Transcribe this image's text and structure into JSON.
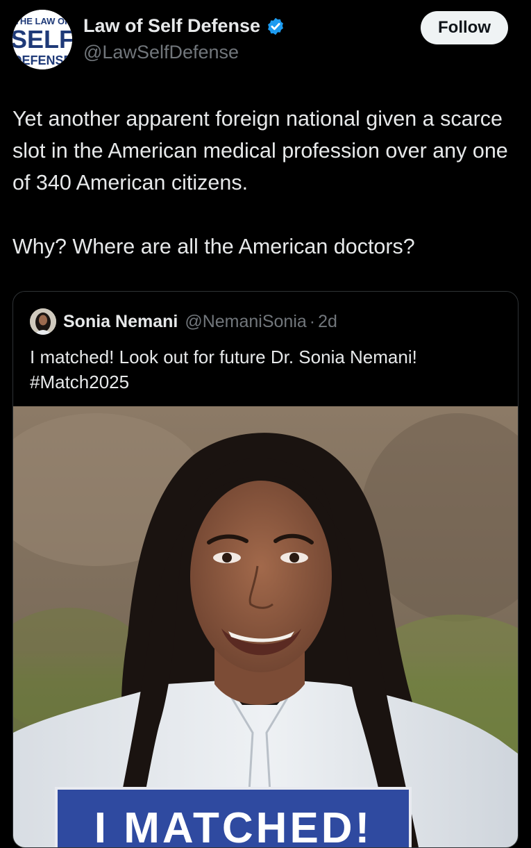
{
  "author": {
    "name": "Law of Self Defense",
    "handle": "@LawSelfDefense",
    "verified": true,
    "avatar_logo_lines": [
      "THE LAW OF",
      "SELF",
      "DEFENSE"
    ]
  },
  "follow_label": "Follow",
  "post_text": {
    "paragraph_1": "Yet another apparent foreign national given a scarce slot in the American medical profession over any one of 340 American citizens.",
    "paragraph_2": "Why? Where are all the American doctors?"
  },
  "quote": {
    "name": "Sonia Nemani",
    "handle": "@NemaniSonia",
    "dot": "·",
    "time": "2d",
    "text_line_1": "I matched! Look out for future Dr. Sonia Nemani!",
    "text_line_2": "#Match2025",
    "photo_sign_text": "I MATCHED!"
  },
  "colors": {
    "background": "#000000",
    "text_primary": "#e7e9ea",
    "text_secondary": "#71767b",
    "verified_badge": "#1d9bf0",
    "follow_bg": "#eff3f4",
    "border": "#2f3336"
  },
  "icons": {
    "verified": "verified-badge-icon"
  }
}
